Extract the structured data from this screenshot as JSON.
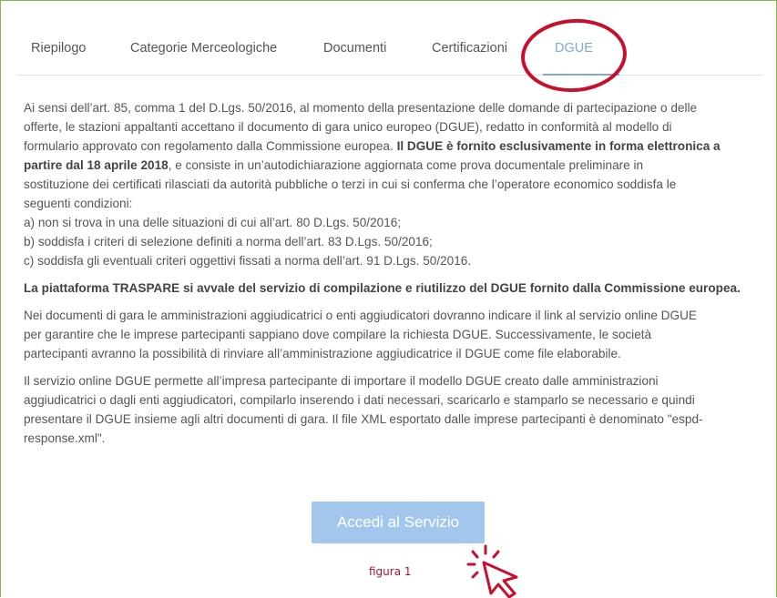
{
  "tabs": [
    {
      "label": "Riepilogo",
      "active": false
    },
    {
      "label": "Categorie Merceologiche",
      "active": false
    },
    {
      "label": "Documenti",
      "active": false
    },
    {
      "label": "Certificazioni",
      "active": false
    },
    {
      "label": "DGUE",
      "active": true
    }
  ],
  "content": {
    "p1_lines": [
      "Ai sensi dell’art. 85, comma 1 del D.Lgs. 50/2016, al momento della presentazione delle domande di partecipazione o delle",
      "offerte, le stazioni appaltanti accettano il documento di gara unico europeo (DGUE), redatto in conformità al modello di",
      "formulario approvato con regolamento dalla Commissione europea."
    ],
    "p1_bold_a": "Il DGUE è fornito esclusivamente in forma elettronica a",
    "p1_bold_b": "partire dal 18 aprile 2018",
    "p1_rest": [
      ", e consiste in un’autodichiarazione aggiornata come prova documentale preliminare in",
      "sostituzione dei certificati rilasciati da autorità pubbliche o terzi in cui si conferma che l’operatore economico soddisfa le",
      "seguenti condizioni:"
    ],
    "list": [
      "a) non si trova in una delle situazioni di cui all’art. 80 D.Lgs. 50/2016;",
      "b) soddisfa i criteri di selezione definiti a norma dell’art. 83 D.Lgs. 50/2016;",
      "c) soddisfa gli eventuali criteri oggettivi fissati a norma dell’art. 91 D.Lgs. 50/2016."
    ],
    "p2": "La piattaforma TRASPARE si avvale del servizio di compilazione e riutilizzo del DGUE fornito dalla Commissione europea.",
    "p3_lines": [
      "Nei documenti di gara le amministrazioni aggiudicatrici o enti aggiudicatori dovranno indicare il link al servizio online DGUE",
      "per garantire che le imprese partecipanti sappiano dove compilare la richiesta DGUE. Successivamente, le società",
      "partecipanti avranno la possibilità di rinviare all’amministrazione aggiudicatrice il DGUE come file elaborabile."
    ],
    "p4_lines": [
      "Il servizio online DGUE permette all’impresa partecipante di importare il modello DGUE creato dalle amministrazioni",
      "aggiudicatrici o dagli enti aggiudicatori, compilarlo inserendo i dati necessari, scaricarlo e stamparlo se necessario e quindi",
      "presentare il DGUE insieme agli altri documenti di gara. Il file XML esportato dalle imprese partecipanti è denominato \"espd-",
      "response.xml\"."
    ]
  },
  "button_label": "Accedi al Servizio",
  "caption": "figura 1",
  "colors": {
    "border": "#7ac143",
    "active_tab": "#7fa9d6",
    "button": "#a3c7ec",
    "annotation": "#c8102e"
  }
}
